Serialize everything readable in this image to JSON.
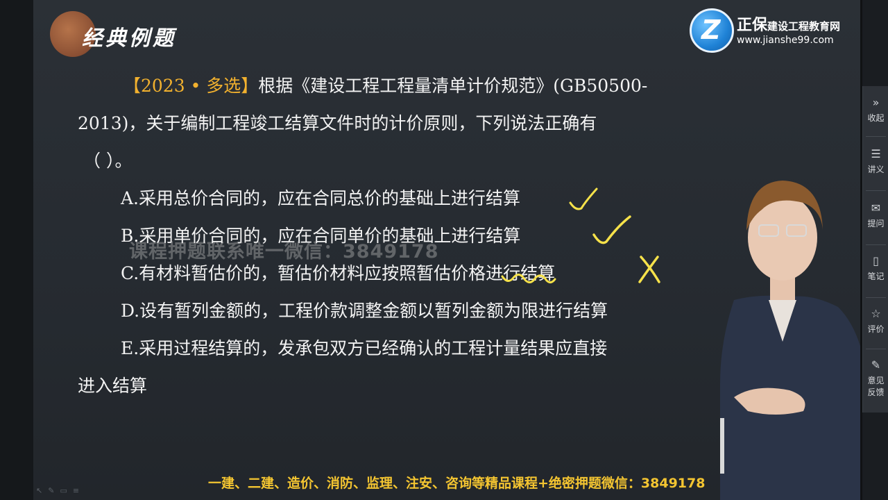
{
  "slide": {
    "heading": "经典例题",
    "logo": {
      "name_big": "正保",
      "name_small": "建设工程教育网",
      "url": "www.jianshe99.com"
    },
    "question": {
      "tag": "【2023 • 多选】",
      "line1": "根据《建设工程工程量清单计价规范》(GB50500-",
      "line2": "2013)，关于编制工程竣工结算文件时的计价原则，下列说法正确有",
      "line3": "（  ）。"
    },
    "options": [
      {
        "text": "A.采用总价合同的，应在合同总价的基础上进行结算"
      },
      {
        "text": "B.采用单价合同的，应在合同单价的基础上进行结算"
      },
      {
        "text": "C.有材料暂估价的，暂估价材料应按照暂估价格进行结算"
      },
      {
        "text": "D.设有暂列金额的，工程价款调整金额以暂列金额为限进行结算"
      },
      {
        "text": "E.采用过程结算的，发承包双方已经确认的工程计量结果应直接"
      }
    ],
    "option_e_cont": "进入结算",
    "watermark": "课程押题联系唯一微信：3849178",
    "banner": "一建、二建、造价、消防、监理、注安、咨询等精品课程+绝密押题微信：3849178"
  },
  "sidebar": {
    "items": [
      {
        "icon": "»",
        "label": "收起"
      },
      {
        "icon": "☰",
        "label": "讲义"
      },
      {
        "icon": "✉",
        "label": "提问"
      },
      {
        "icon": "▯",
        "label": "笔记"
      },
      {
        "icon": "☆",
        "label": "评价"
      },
      {
        "icon": "✎",
        "label": "意见",
        "label2": "反馈"
      }
    ]
  },
  "colors": {
    "tag": "#f2b12e",
    "annotation": "#f6e24a",
    "banner": "#f4c531"
  }
}
